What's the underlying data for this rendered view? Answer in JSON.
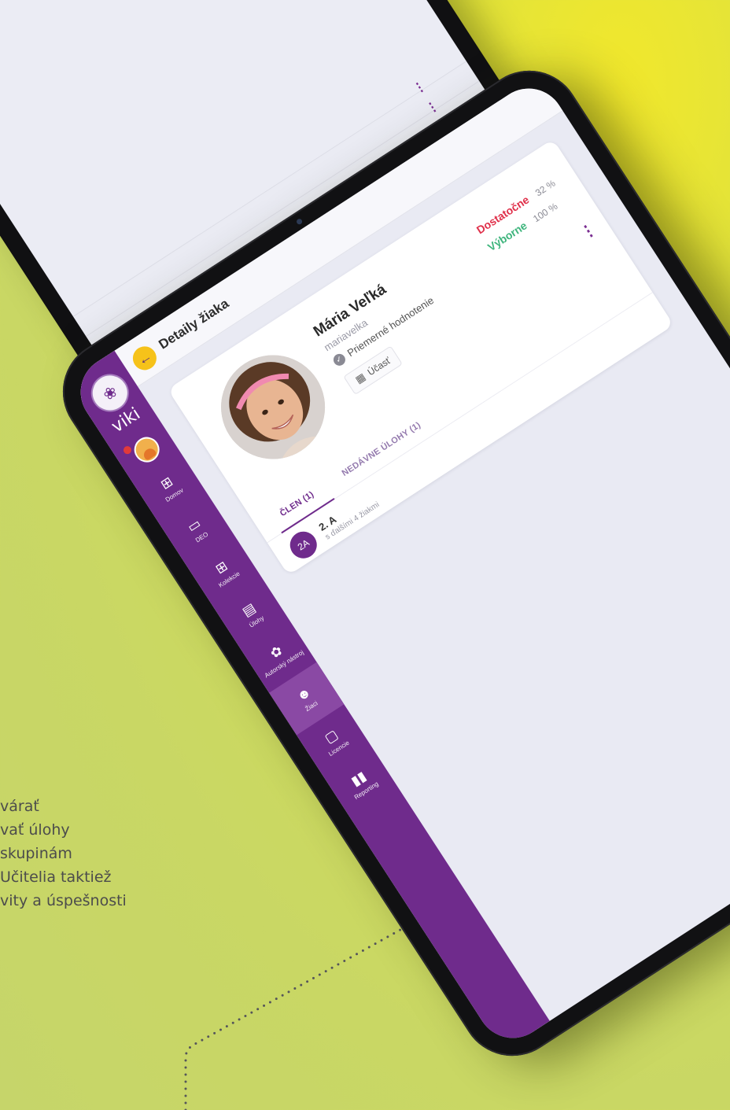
{
  "app": {
    "name": "viki",
    "page_title": "Detaily žiaka"
  },
  "sidebar": {
    "items": [
      {
        "label": "Domov",
        "icon": "home-grid-icon"
      },
      {
        "label": "DEO",
        "icon": "monitor-icon"
      },
      {
        "label": "Kolekcie",
        "icon": "grid-icon"
      },
      {
        "label": "Úlohy",
        "icon": "clipboard-icon"
      },
      {
        "label": "Autorský nástroj",
        "icon": "palette-icon"
      },
      {
        "label": "Žiaci",
        "icon": "people-icon",
        "active": true
      },
      {
        "label": "Licencie",
        "icon": "license-icon"
      },
      {
        "label": "Reporting",
        "icon": "bar-chart-icon"
      }
    ]
  },
  "student": {
    "name": "Mária Veľká",
    "username": "mariavelka",
    "rating": "Priemerné hodnotenie",
    "attendance_button": "Účasť",
    "grades": [
      {
        "label": "Dostatočne",
        "percent": "32 %",
        "color": "#e0314b"
      },
      {
        "label": "Výborne",
        "percent": "100 %",
        "color": "#3fb57d"
      }
    ]
  },
  "tabs": [
    {
      "label": "ČLEN (1)"
    },
    {
      "label": "NEDÁVNE ÚLOHY (1)"
    }
  ],
  "membership": {
    "avatar": "2A",
    "name": "2. A",
    "sub": "s ďalšími 4 žiakmi"
  },
  "background_text": {
    "lines": [
      "várať",
      "vať úlohy",
      "skupinám",
      "Učitelia taktiež",
      "vity a úspešnosti"
    ]
  },
  "colors": {
    "brand": "#6f2b8c",
    "accent": "#f6c21a"
  }
}
